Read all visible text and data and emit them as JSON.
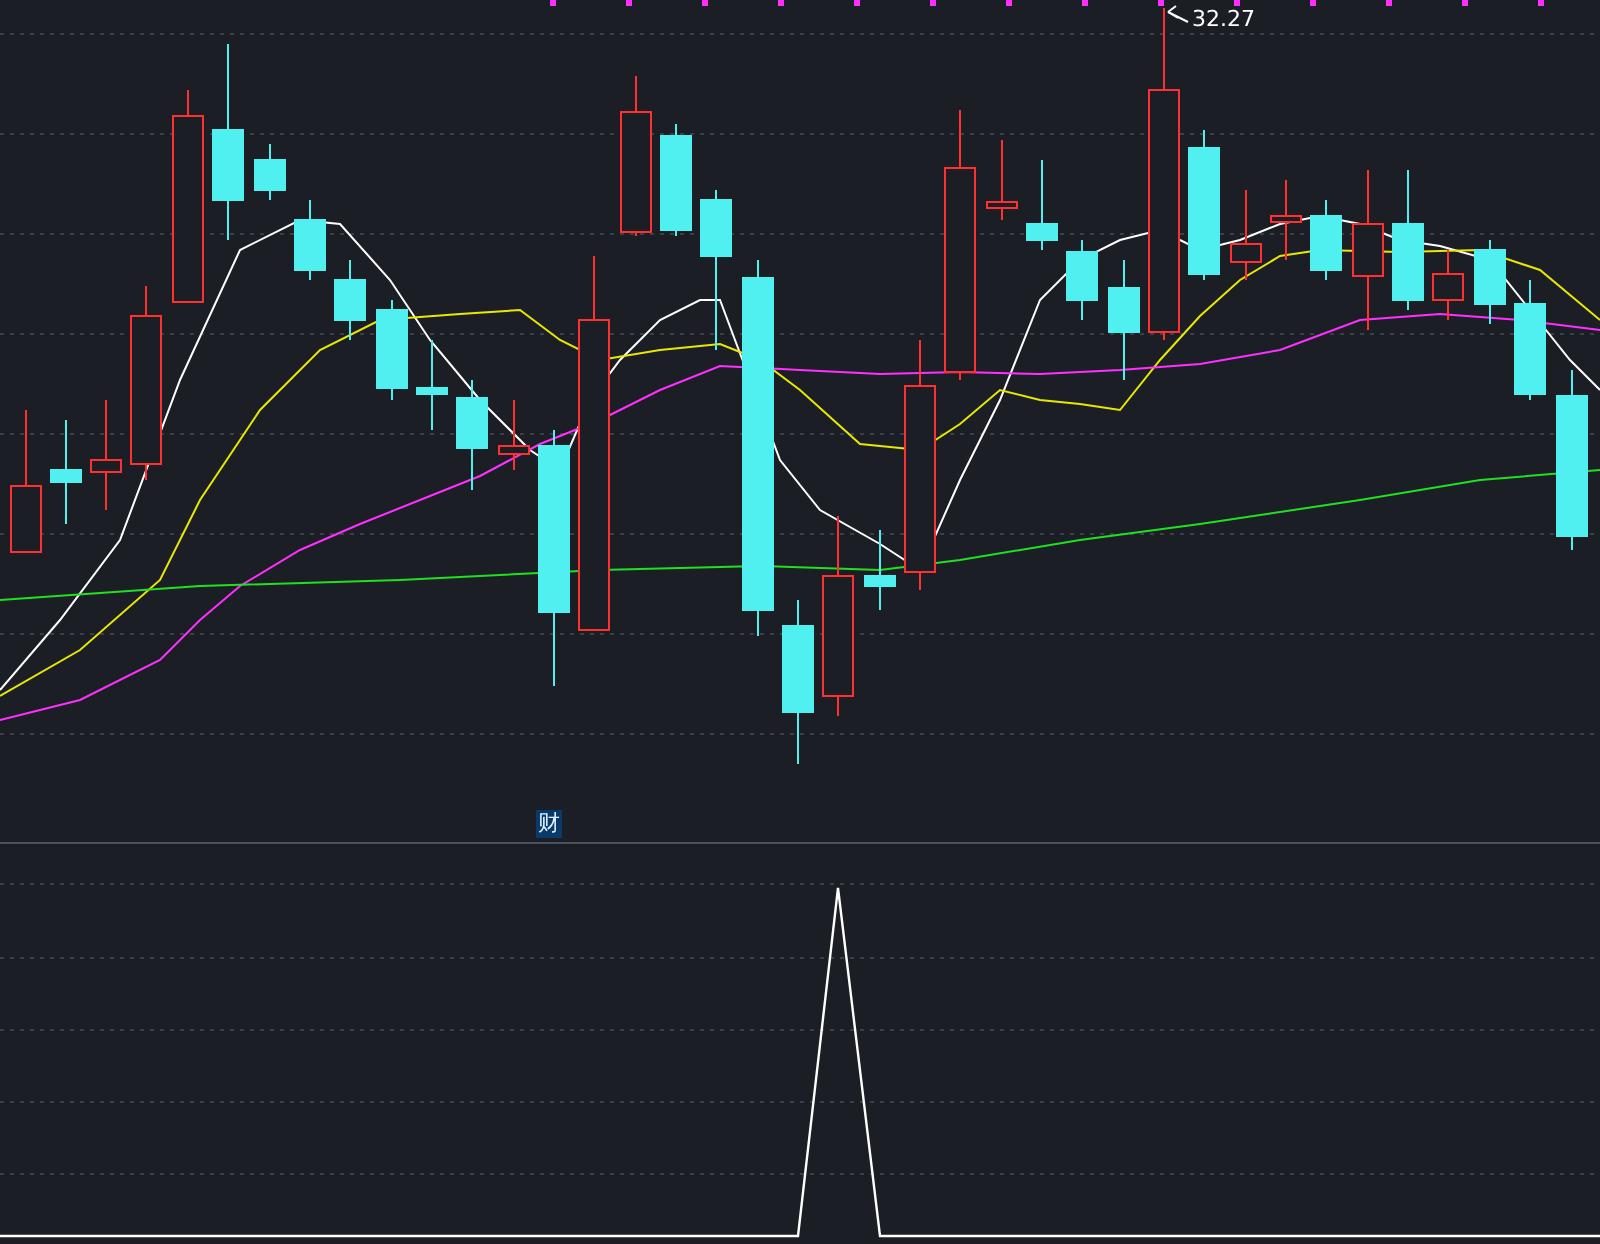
{
  "price_chart": {
    "high_label": "32.27"
  },
  "indicator_panel": {
    "marker": "财"
  }
}
